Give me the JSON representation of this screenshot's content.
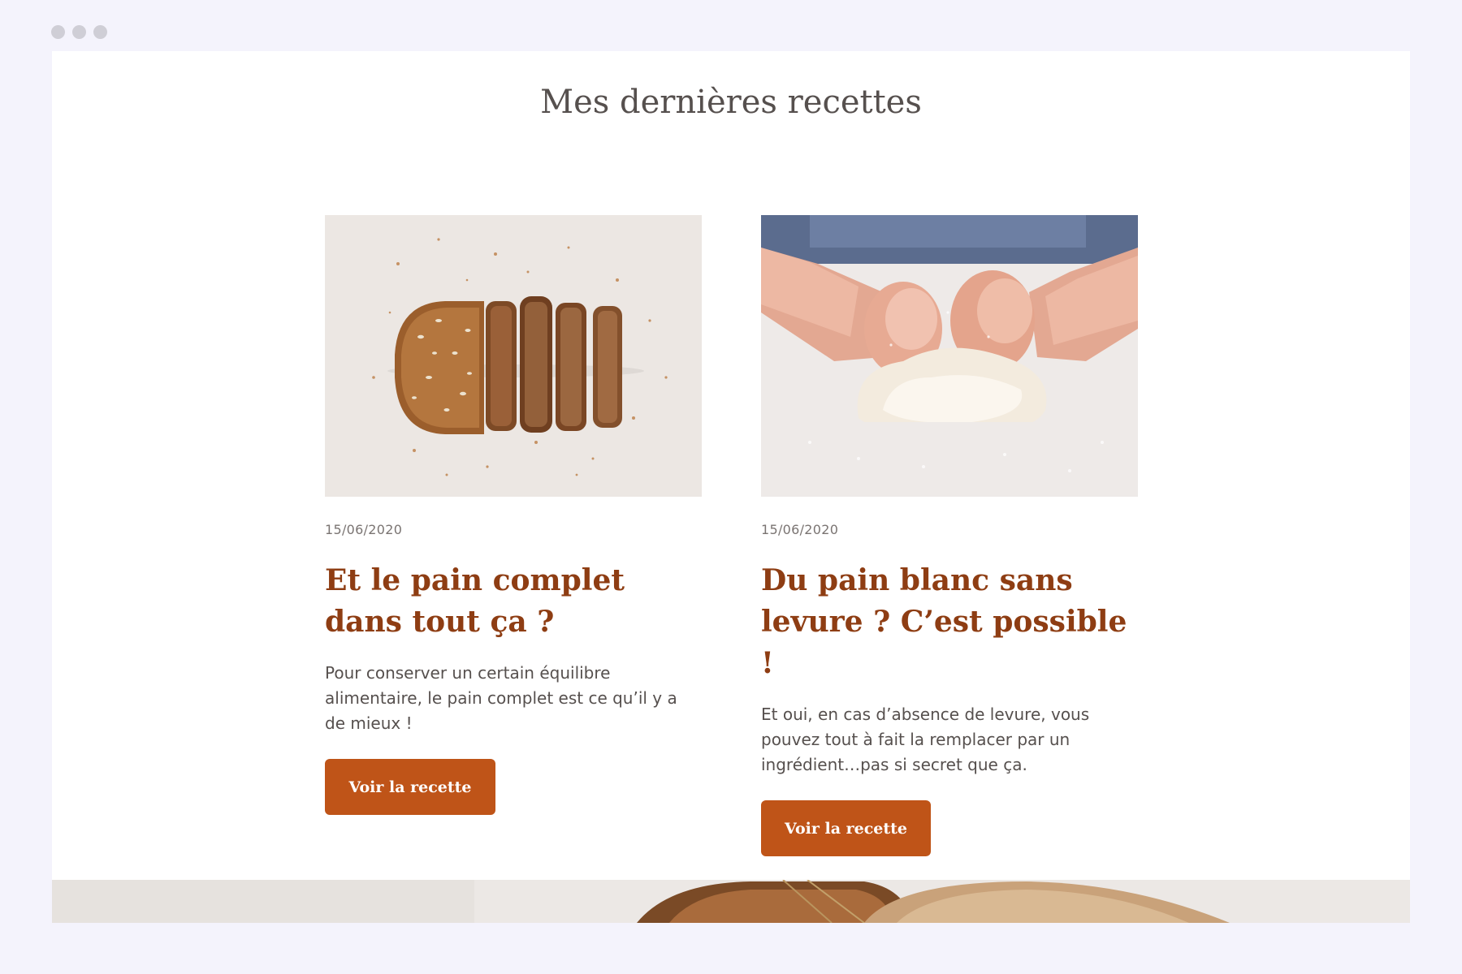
{
  "window": {
    "controls": [
      "close",
      "minimize",
      "maximize"
    ]
  },
  "section": {
    "title": "Mes dernières recettes"
  },
  "cards": [
    {
      "image": "sliced-whole-grain-bread-photo",
      "date": "15/06/2020",
      "title": "Et le pain complet dans tout ça ?",
      "excerpt": "Pour conserver un certain équilibre alimentaire, le pain complet est ce qu’il y a de mieux !",
      "button_label": "Voir la recette"
    },
    {
      "image": "hands-kneading-dough-photo",
      "date": "15/06/2020",
      "title": "Du pain blanc sans levure ? C’est possible !",
      "excerpt": "Et oui, en cas d’absence de levure, vous pouvez tout à fait la remplacer par un ingrédient…pas si secret que ça.",
      "button_label": "Voir la recette"
    }
  ],
  "banner": {
    "image": "bread-loaf-banner-photo"
  },
  "colors": {
    "page_background": "#f4f3fc",
    "title": "#56504e",
    "card_title": "#8e3d13",
    "button": "#bf5418",
    "button_text": "#ffffff"
  }
}
